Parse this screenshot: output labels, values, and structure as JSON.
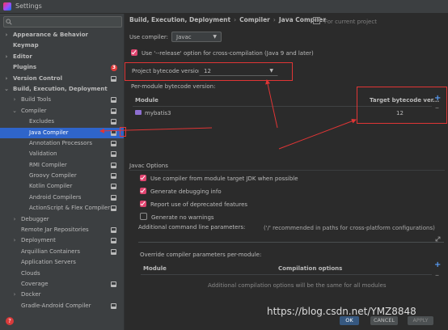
{
  "window": {
    "title": "Settings"
  },
  "search": {
    "placeholder": ""
  },
  "sidebar": {
    "items": [
      {
        "label": "Appearance & Behavior",
        "level": 0,
        "arrow": "›",
        "bold": true
      },
      {
        "label": "Keymap",
        "level": 0,
        "arrow": "",
        "bold": true
      },
      {
        "label": "Editor",
        "level": 0,
        "arrow": "›",
        "bold": true
      },
      {
        "label": "Plugins",
        "level": 0,
        "arrow": "",
        "bold": true,
        "badge": "3"
      },
      {
        "label": "Version Control",
        "level": 0,
        "arrow": "›",
        "bold": true,
        "project": true
      },
      {
        "label": "Build, Execution, Deployment",
        "level": 0,
        "arrow": "⌄",
        "bold": true
      },
      {
        "label": "Build Tools",
        "level": 1,
        "arrow": "›",
        "project": true
      },
      {
        "label": "Compiler",
        "level": 1,
        "arrow": "⌄",
        "project": true
      },
      {
        "label": "Excludes",
        "level": 2,
        "arrow": "",
        "project": true
      },
      {
        "label": "Java Compiler",
        "level": 2,
        "arrow": "",
        "project": true,
        "selected": true
      },
      {
        "label": "Annotation Processors",
        "level": 2,
        "arrow": "",
        "project": true
      },
      {
        "label": "Validation",
        "level": 2,
        "arrow": "",
        "project": true
      },
      {
        "label": "RMI Compiler",
        "level": 2,
        "arrow": "",
        "project": true
      },
      {
        "label": "Groovy Compiler",
        "level": 2,
        "arrow": "",
        "project": true
      },
      {
        "label": "Kotlin Compiler",
        "level": 2,
        "arrow": "",
        "project": true
      },
      {
        "label": "Android Compilers",
        "level": 2,
        "arrow": "",
        "project": true
      },
      {
        "label": "ActionScript & Flex Compiler",
        "level": 2,
        "arrow": "",
        "project": true
      },
      {
        "label": "Debugger",
        "level": 1,
        "arrow": "›"
      },
      {
        "label": "Remote Jar Repositories",
        "level": 1,
        "arrow": "",
        "project": true
      },
      {
        "label": "Deployment",
        "level": 1,
        "arrow": "›",
        "project": true
      },
      {
        "label": "Arquillian Containers",
        "level": 1,
        "arrow": "",
        "project": true
      },
      {
        "label": "Application Servers",
        "level": 1,
        "arrow": ""
      },
      {
        "label": "Clouds",
        "level": 1,
        "arrow": ""
      },
      {
        "label": "Coverage",
        "level": 1,
        "arrow": "",
        "project": true
      },
      {
        "label": "Docker",
        "level": 1,
        "arrow": "›"
      },
      {
        "label": "Gradle-Android Compiler",
        "level": 1,
        "arrow": "",
        "project": true
      }
    ]
  },
  "breadcrumb": {
    "part1": "Build, Execution, Deployment",
    "part2": "Compiler",
    "part3": "Java Compiler",
    "sep": "›",
    "scope": "For current project"
  },
  "compiler": {
    "use_label": "Use compiler:",
    "use_value": "Javac",
    "release_label": "Use '--release' option for cross-compilation (Java 9 and later)",
    "release_checked": true,
    "bytecode_label": "Project bytecode version:",
    "bytecode_value": "12",
    "per_module_label": "Per-module bytecode version:"
  },
  "module_table": {
    "col_module": "Module",
    "col_target": "Target bytecode ver...",
    "rows": [
      {
        "module": "mybatis3",
        "target": "12"
      }
    ]
  },
  "javac": {
    "section_label": "Javac Options",
    "options": [
      {
        "label": "Use compiler from module target JDK when possible",
        "checked": true
      },
      {
        "label": "Generate debugging info",
        "checked": true
      },
      {
        "label": "Report use of deprecated features",
        "checked": true
      },
      {
        "label": "Generate no warnings",
        "checked": false
      }
    ],
    "additional_label": "Additional command line parameters:",
    "additional_hint": "('/' recommended in paths for cross-platform configurations)"
  },
  "override": {
    "label": "Override compiler parameters per-module:",
    "col_module": "Module",
    "col_options": "Compilation options",
    "hint": "Additional compilation options will be the same for all modules"
  },
  "footer": {
    "ok": "OK",
    "cancel": "CANCEL",
    "apply": "APPLY",
    "help": "?"
  },
  "watermark": "https://blog.csdn.net/YMZ8848",
  "colors": {
    "accent": "#2f65ca",
    "checkbox": "#e0446f",
    "annotation": "#e03535"
  },
  "icons": {
    "search": "search-icon",
    "project": "project-scope-icon",
    "module": "module-icon",
    "add": "plus-icon",
    "remove": "minus-icon",
    "expand": "expand-icon"
  }
}
